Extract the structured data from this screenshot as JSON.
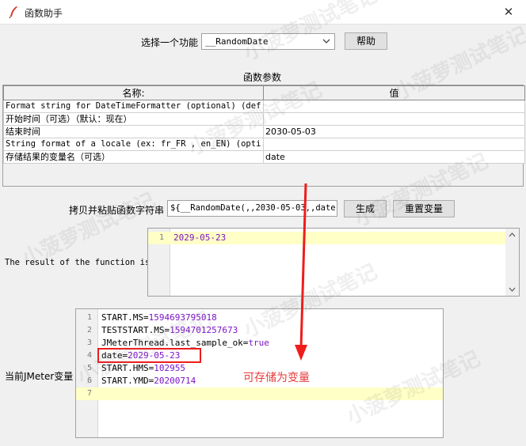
{
  "window": {
    "title": "函数助手",
    "close_glyph": "✕"
  },
  "function_select": {
    "label": "选择一个功能",
    "value": "__RandomDate",
    "help_label": "帮助"
  },
  "params": {
    "section_title": "函数参数",
    "col_name": "名称:",
    "col_value": "值",
    "rows": [
      {
        "name": "Format string for DateTimeFormatter (optional) (def...",
        "value": ""
      },
      {
        "name": "开始时间（可选）（默认：现在）",
        "value": ""
      },
      {
        "name": "结束时间",
        "value": "2030-05-03"
      },
      {
        "name": "String format of a locale (ex: fr_FR , en_EN) (opti...",
        "value": ""
      },
      {
        "name": "存储结果的变量名（可选）",
        "value": "date"
      }
    ]
  },
  "copy_row": {
    "label": "拷贝并粘贴函数字符串",
    "function_string": "${__RandomDate(,,2030-05-03,,date)}",
    "generate_label": "生成",
    "reset_label": "重置变量"
  },
  "result": {
    "label": "The result of the function is",
    "lines": [
      {
        "num": "1",
        "value": "2029-05-23"
      }
    ]
  },
  "vars": {
    "label": "当前JMeter变量",
    "lines": [
      {
        "num": "1",
        "key": "START.MS=",
        "value": "1594693795018"
      },
      {
        "num": "2",
        "key": "TESTSTART.MS=",
        "value": "1594701257673"
      },
      {
        "num": "3",
        "key": "JMeterThread.last_sample_ok=",
        "value": "true"
      },
      {
        "num": "4",
        "key": "date=",
        "value": "2029-05-23"
      },
      {
        "num": "5",
        "key": "START.HMS=",
        "value": "102955"
      },
      {
        "num": "6",
        "key": "START.YMD=",
        "value": "20200714"
      },
      {
        "num": "7",
        "key": "",
        "value": ""
      }
    ]
  },
  "annotation": {
    "text": "可存储为变量",
    "color": "#e83a3a"
  },
  "watermark": {
    "text": "小菠萝测试笔记"
  },
  "colors": {
    "accent_red": "#ef1c1c",
    "var_value": "#7b14c6",
    "highlight": "#ffffc6"
  }
}
